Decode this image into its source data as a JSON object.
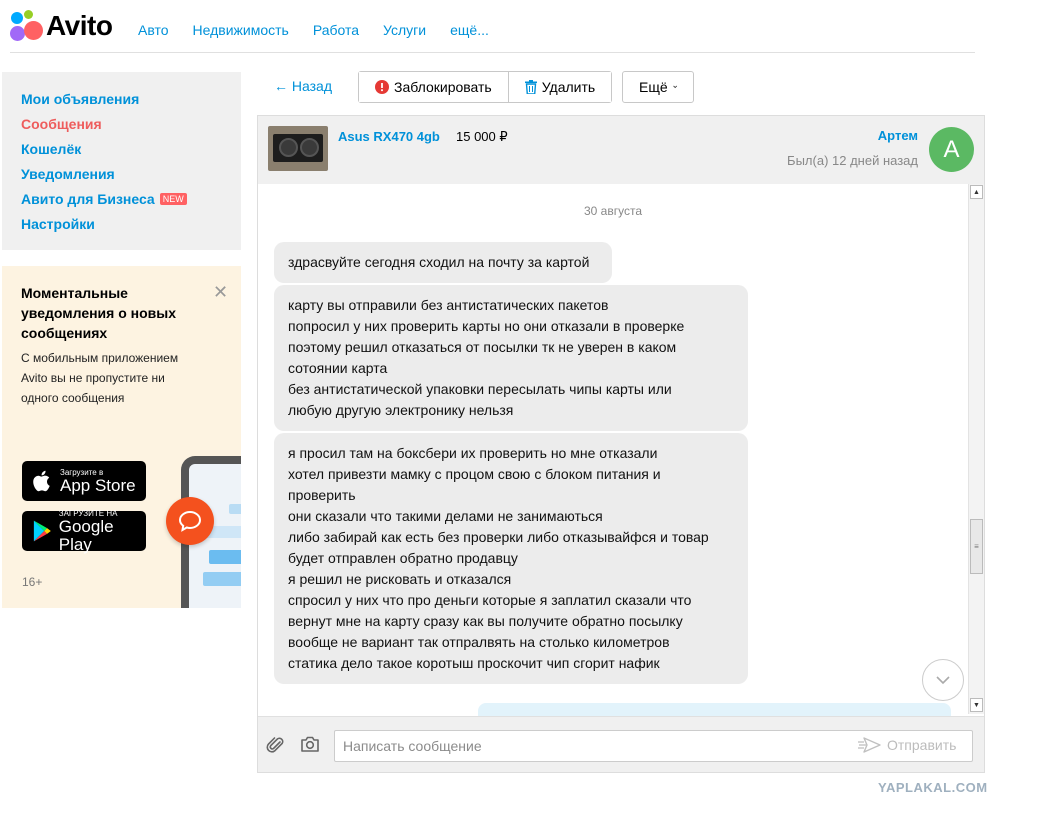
{
  "header": {
    "logo_text": "Avito",
    "nav": [
      "Авто",
      "Недвижимость",
      "Работа",
      "Услуги",
      "ещё..."
    ]
  },
  "sidebar": {
    "items": [
      {
        "label": "Мои объявления"
      },
      {
        "label": "Сообщения",
        "active": true
      },
      {
        "label": "Кошелёк"
      },
      {
        "label": "Уведомления"
      },
      {
        "label": "Авито для Бизнеса",
        "badge": "NEW"
      },
      {
        "label": "Настройки"
      }
    ]
  },
  "promo": {
    "title": "Моментальные уведомления о новых сообщениях",
    "text": "С мобильным приложением Avito вы не пропустите ни одного сообщения",
    "appstore_small": "Загрузите в",
    "appstore_big": "App Store",
    "gplay_small": "ЗАГРУЗИТЕ НА",
    "gplay_big": "Google Play",
    "age": "16+"
  },
  "toolbar": {
    "back": "← Назад",
    "block": "Заблокировать",
    "delete": "Удалить",
    "more": "Ещё"
  },
  "chat": {
    "item_title": "Asus RX470 4gb",
    "item_price": "15 000 ₽",
    "user_name": "Артем",
    "user_seen": "Был(а) 12 дней назад",
    "avatar_letter": "A",
    "date": "30 августа",
    "messages": [
      "здрасвуйте сегодня сходил на почту за картой",
      "карту  вы отправили   без антистатических пакетов\nпопросил у них проверить карты   но они отказали  в проверке\nпоэтому решил отказаться от посылки  тк не уверен в  каком\nсотоянии карта\nбез антистатической  упаковки пересылать  чипы карты  или\nлюбую другую электронику нельзя",
      "я просил  там на боксбери их проверить но мне отказали\nхотел привезти мамку с процом   свою с блоком питания и\nпроверить\nони сказали что такими делами не занимаються\nлибо забирай  как есть без проверки  либо отказывайфся и товар\nбудет отправлен обратно продавцу\nя решил не рисковать и отказался\nспросил у них что про деньги которые я заплатил сказали что\nвернут мне на карту  сразу как  вы получите обратно посылку\nвообще не вариант так отпралвять   на столько километров\nстатика дело такое коротыш проскочит чип сгорит нафик"
    ],
    "input_placeholder": "Написать сообщение",
    "send": "Отправить"
  },
  "watermark": "YAPLAKAL.COM",
  "colors": {
    "link": "#0091d9",
    "active": "#ee5d5d",
    "avatar": "#5bb963",
    "promo_bg": "#fdf3e1"
  }
}
